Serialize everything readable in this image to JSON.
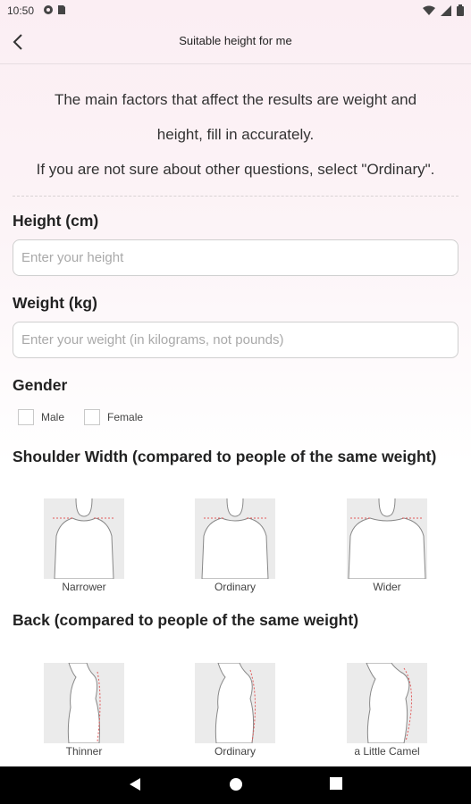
{
  "status": {
    "time": "10:50"
  },
  "appbar": {
    "title": "Suitable height for me"
  },
  "intro": {
    "line1": "The main factors that affect the results are weight and",
    "line2": "height, fill in accurately.",
    "line3": "If you are not sure about other questions, select \"Ordinary\"."
  },
  "height": {
    "label": "Height (cm)",
    "placeholder": "Enter your height",
    "value": ""
  },
  "weight": {
    "label": "Weight (kg)",
    "placeholder": "Enter your weight (in kilograms, not pounds)",
    "value": ""
  },
  "gender": {
    "label": "Gender",
    "options": [
      "Male",
      "Female"
    ]
  },
  "shoulder": {
    "label": "Shoulder Width (compared to people of the same weight)",
    "options": [
      "Narrower",
      "Ordinary",
      "Wider"
    ]
  },
  "back": {
    "label": "Back (compared to people of the same weight)",
    "options": [
      "Thinner",
      "Ordinary",
      "a Little Camel"
    ]
  },
  "icons": {
    "status_left": [
      "gear-icon",
      "sim-icon"
    ],
    "status_right": [
      "wifi-icon",
      "signal-icon",
      "battery-icon"
    ],
    "nav": [
      "back-triangle-icon",
      "home-circle-icon",
      "recents-square-icon"
    ]
  },
  "colors": {
    "guide_line": "#e05a5a",
    "figure_bg": "#ebebeb"
  }
}
